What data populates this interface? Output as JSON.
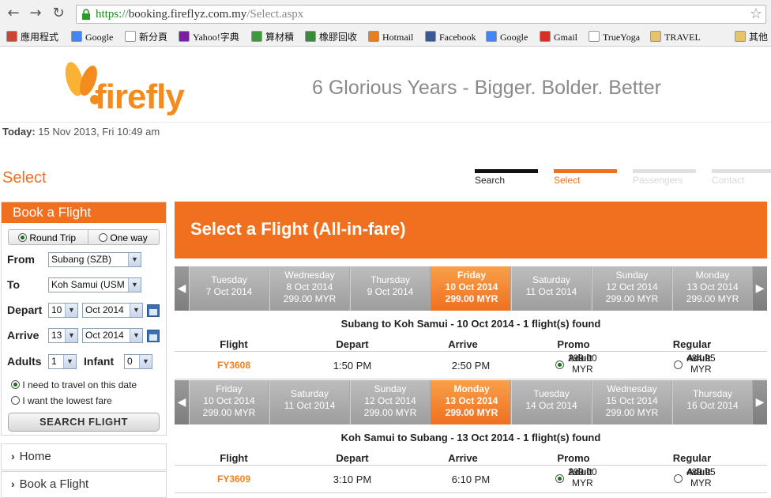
{
  "browser": {
    "url_https": "https://",
    "url_host": "booking.fireflyz.com.my",
    "url_path": "/Select.aspx",
    "bookmarks": [
      "應用程式",
      "Google",
      "新分頁",
      "Yahoo!字典",
      "算材積",
      "橡膠回收",
      "Hotmail",
      "Facebook",
      "Google",
      "Gmail",
      "TrueYoga",
      "TRAVEL",
      "其他"
    ]
  },
  "header": {
    "logo": "firefly",
    "tagline": "6 Glorious Years - Bigger. Bolder. Better"
  },
  "today": {
    "label": "Today:",
    "value": "15 Nov 2013, Fri 10:49 am"
  },
  "page_title": "Select",
  "steps": [
    {
      "label": "Search",
      "state": "done"
    },
    {
      "label": "Select",
      "state": "current"
    },
    {
      "label": "Passengers",
      "state": "todo"
    },
    {
      "label": "Contact",
      "state": "todo"
    }
  ],
  "book": {
    "title": "Book a Flight",
    "round_trip": "Round Trip",
    "one_way": "One way",
    "from_label": "From",
    "from_value": "Subang (SZB)",
    "to_label": "To",
    "to_value": "Koh Samui (USM",
    "depart_label": "Depart",
    "depart_day": "10",
    "depart_month": "Oct 2014",
    "arrive_label": "Arrive",
    "arrive_day": "13",
    "arrive_month": "Oct 2014",
    "adults_label": "Adults",
    "adults_value": "1",
    "infant_label": "Infant",
    "infant_value": "0",
    "opt_date": "I need to travel on this date",
    "opt_lowest": "I want the lowest fare",
    "search_button": "SEARCH FLIGHT"
  },
  "sidenav": [
    "Home",
    "Book a Flight"
  ],
  "main_title": "Select a Flight (All-in-fare)",
  "outbound": {
    "dates": [
      {
        "day": "Tuesday",
        "date": "7 Oct 2014",
        "price": ""
      },
      {
        "day": "Wednesday",
        "date": "8 Oct 2014",
        "price": "299.00 MYR"
      },
      {
        "day": "Thursday",
        "date": "9 Oct 2014",
        "price": ""
      },
      {
        "day": "Friday",
        "date": "10 Oct 2014",
        "price": "299.00 MYR"
      },
      {
        "day": "Saturday",
        "date": "11 Oct 2014",
        "price": ""
      },
      {
        "day": "Sunday",
        "date": "12 Oct 2014",
        "price": "299.00 MYR"
      },
      {
        "day": "Monday",
        "date": "13 Oct 2014",
        "price": "299.00 MYR"
      }
    ],
    "selected_index": 3,
    "found": "Subang to Koh Samui - 10 Oct 2014 - 1  flight(s) found",
    "flight": "FY3608",
    "depart": "1:50 PM",
    "arrive": "2:50 PM",
    "promo_label": "Adult",
    "promo_price": "299.00 MYR",
    "regular_label": "Adult",
    "regular_price": "484.95 MYR"
  },
  "inbound": {
    "dates": [
      {
        "day": "Friday",
        "date": "10 Oct 2014",
        "price": "299.00 MYR"
      },
      {
        "day": "Saturday",
        "date": "11 Oct 2014",
        "price": ""
      },
      {
        "day": "Sunday",
        "date": "12 Oct 2014",
        "price": "299.00 MYR"
      },
      {
        "day": "Monday",
        "date": "13 Oct 2014",
        "price": "299.00 MYR"
      },
      {
        "day": "Tuesday",
        "date": "14 Oct 2014",
        "price": ""
      },
      {
        "day": "Wednesday",
        "date": "15 Oct 2014",
        "price": "299.00 MYR"
      },
      {
        "day": "Thursday",
        "date": "16 Oct 2014",
        "price": ""
      }
    ],
    "selected_index": 3,
    "found": "Koh Samui to Subang - 13 Oct 2014 - 1  flight(s) found",
    "flight": "FY3609",
    "depart": "3:10 PM",
    "arrive": "6:10 PM",
    "promo_label": "Adult",
    "promo_price": "299.00 MYR",
    "regular_label": "Adult",
    "regular_price": "489.95 MYR"
  },
  "columns": [
    "Flight",
    "Depart",
    "Arrive",
    "Promo",
    "Regular"
  ],
  "colors": {
    "brand_orange": "#f07020",
    "link_orange": "#f08020",
    "strip_grey": "#a8a8a8"
  }
}
